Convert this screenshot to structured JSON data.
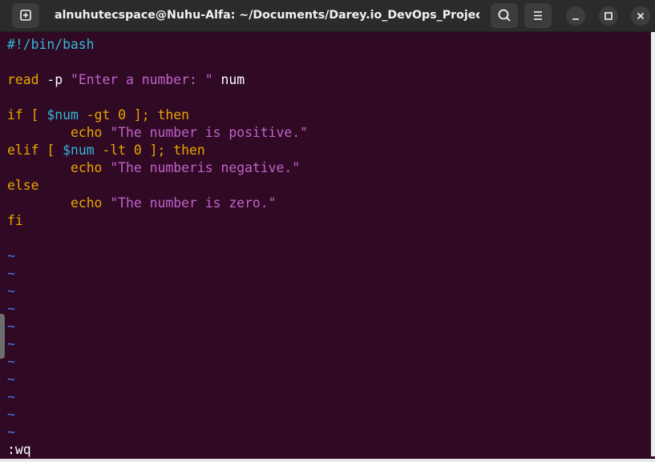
{
  "window": {
    "title": "alnuhutecspace@Nuhu-Alfa: ~/Documents/Darey.io_DevOps_Projects/Lin..."
  },
  "titlebar_icons": {
    "new_tab": "new-tab-icon",
    "search": "search-icon",
    "menu": "hamburger-menu-icon",
    "minimize": "minimize-icon",
    "maximize": "maximize-icon",
    "close": "close-icon"
  },
  "colors": {
    "terminal_bg": "#300a24",
    "titlebar_bg": "#2b2b2b",
    "comment": "#34b8d6",
    "keyword": "#e8a500",
    "string": "#c063c9",
    "variable": "#34b8d6",
    "tilde": "#4a7cf0"
  },
  "editor": {
    "lines": {
      "l1": {
        "comment": "#!/bin/bash"
      },
      "l3": {
        "kw": "read",
        "opt": " -p ",
        "str": "\"Enter a number: \"",
        "rest": " num"
      },
      "l5": {
        "kw1": "if",
        "br1": " [ ",
        "var": "$num",
        "op": " -gt 0 ]",
        "semi": "; ",
        "kw2": "then"
      },
      "l6": {
        "indent": "        ",
        "kw": "echo",
        "sp": " ",
        "str": "\"The number is positive.\""
      },
      "l7": {
        "kw1": "elif",
        "br1": " [ ",
        "var": "$num",
        "op": " -lt 0 ]",
        "semi": "; ",
        "kw2": "then"
      },
      "l8": {
        "indent": "        ",
        "kw": "echo",
        "sp": " ",
        "str": "\"The numberis negative.\""
      },
      "l9": {
        "kw": "else"
      },
      "l10": {
        "indent": "        ",
        "kw": "echo",
        "sp": " ",
        "str": "\"The number is zero.\""
      },
      "l11": {
        "kw": "fi"
      }
    },
    "tilde": "~",
    "command": ":wq"
  }
}
